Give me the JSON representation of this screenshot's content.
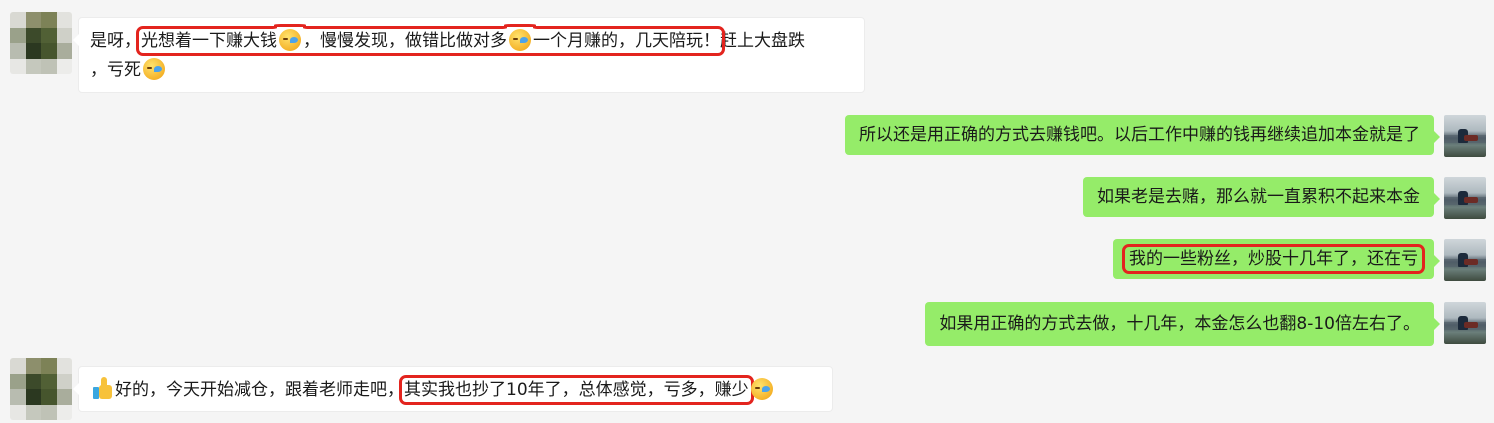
{
  "colors": {
    "incoming_bg": "#ffffff",
    "outgoing_bg": "#95ec69",
    "highlight": "#e3241e",
    "chat_bg": "#f5f5f5"
  },
  "messages": [
    {
      "side": "in",
      "line1_pre": "是呀，",
      "line1_hl_a": "光想着一下赚大钱",
      "line1_hl_b": "，慢慢发现，做错比做对多",
      "line1_hl_c": "一个月赚的，几天陪玩！",
      "line1_post": "赶上大盘跌",
      "line2": "，亏死",
      "emoji": "laughing-tears-emoji"
    },
    {
      "side": "out",
      "text": "所以还是用正确的方式去赚钱吧。以后工作中赚的钱再继续追加本金就是了"
    },
    {
      "side": "out",
      "text": "如果老是去赌，那么就一直累积不起来本金"
    },
    {
      "side": "out",
      "text": "我的一些粉丝，炒股十几年了，还在亏",
      "highlighted": true
    },
    {
      "side": "out",
      "text": "如果用正确的方式去做，十几年，本金怎么也翻8-10倍左右了。"
    },
    {
      "side": "in",
      "pre": "好的，今天开始减仓，跟着老师走吧，",
      "hl": "其实我也抄了10年了，总体感觉，亏多，赚少",
      "emoji": "thumbs-up-emoji"
    }
  ]
}
